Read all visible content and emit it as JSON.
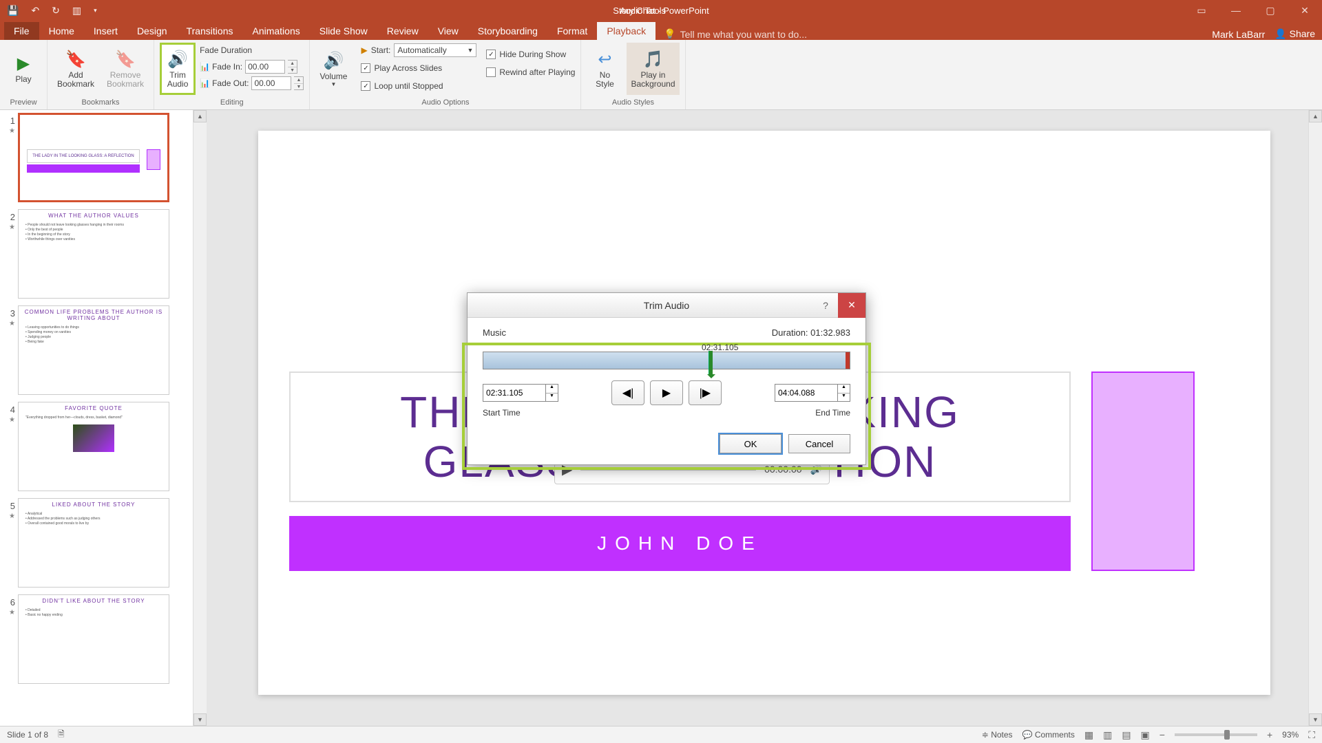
{
  "titlebar": {
    "doc_title": "Story Chat - PowerPoint",
    "contextual_title": "Audio Tools",
    "user": "Mark LaBarr",
    "share": "Share"
  },
  "tabs": {
    "file": "File",
    "home": "Home",
    "insert": "Insert",
    "design": "Design",
    "transitions": "Transitions",
    "animations": "Animations",
    "slideshow": "Slide Show",
    "review": "Review",
    "view": "View",
    "storyboarding": "Storyboarding",
    "format": "Format",
    "playback": "Playback",
    "tellme": "Tell me what you want to do..."
  },
  "ribbon": {
    "preview": {
      "play": "Play",
      "group": "Preview"
    },
    "bookmarks": {
      "add1": "Add",
      "add2": "Bookmark",
      "rem1": "Remove",
      "rem2": "Bookmark",
      "group": "Bookmarks"
    },
    "editing": {
      "trim1": "Trim",
      "trim2": "Audio",
      "fadedur": "Fade Duration",
      "fadein": "Fade In:",
      "fadeout": "Fade Out:",
      "val_in": "00.00",
      "val_out": "00.00",
      "group": "Editing"
    },
    "audio_options": {
      "volume": "Volume",
      "start": "Start:",
      "start_val": "Automatically",
      "play_across": "Play Across Slides",
      "loop": "Loop until Stopped",
      "hide": "Hide During Show",
      "rewind": "Rewind after Playing",
      "group": "Audio Options"
    },
    "audio_styles": {
      "no1": "No",
      "no2": "Style",
      "bg1": "Play in",
      "bg2": "Background",
      "group": "Audio Styles"
    }
  },
  "thumbs": {
    "titles": [
      "THE LADY IN THE LOOKING GLASS: A REFLECTION",
      "WHAT THE AUTHOR VALUES",
      "COMMON LIFE PROBLEMS THE AUTHOR IS WRITING ABOUT",
      "FAVORITE QUOTE",
      "LIKED ABOUT THE STORY",
      "DIDN'T LIKE ABOUT THE STORY"
    ]
  },
  "slide": {
    "title": "THE LADY IN THE LOOKING GLASS: A REFLECTION",
    "author": "JOHN DOE",
    "audio_time": "00:00.00"
  },
  "dialog": {
    "title": "Trim Audio",
    "name": "Music",
    "duration_label": "Duration:",
    "duration": "01:32.983",
    "playhead": "02:31.105",
    "start_time": "02:31.105",
    "end_time": "04:04.088",
    "start_label": "Start Time",
    "end_label": "End Time",
    "ok": "OK",
    "cancel": "Cancel"
  },
  "status": {
    "slide": "Slide 1 of 8",
    "notes": "Notes",
    "comments": "Comments",
    "zoom": "93%"
  }
}
